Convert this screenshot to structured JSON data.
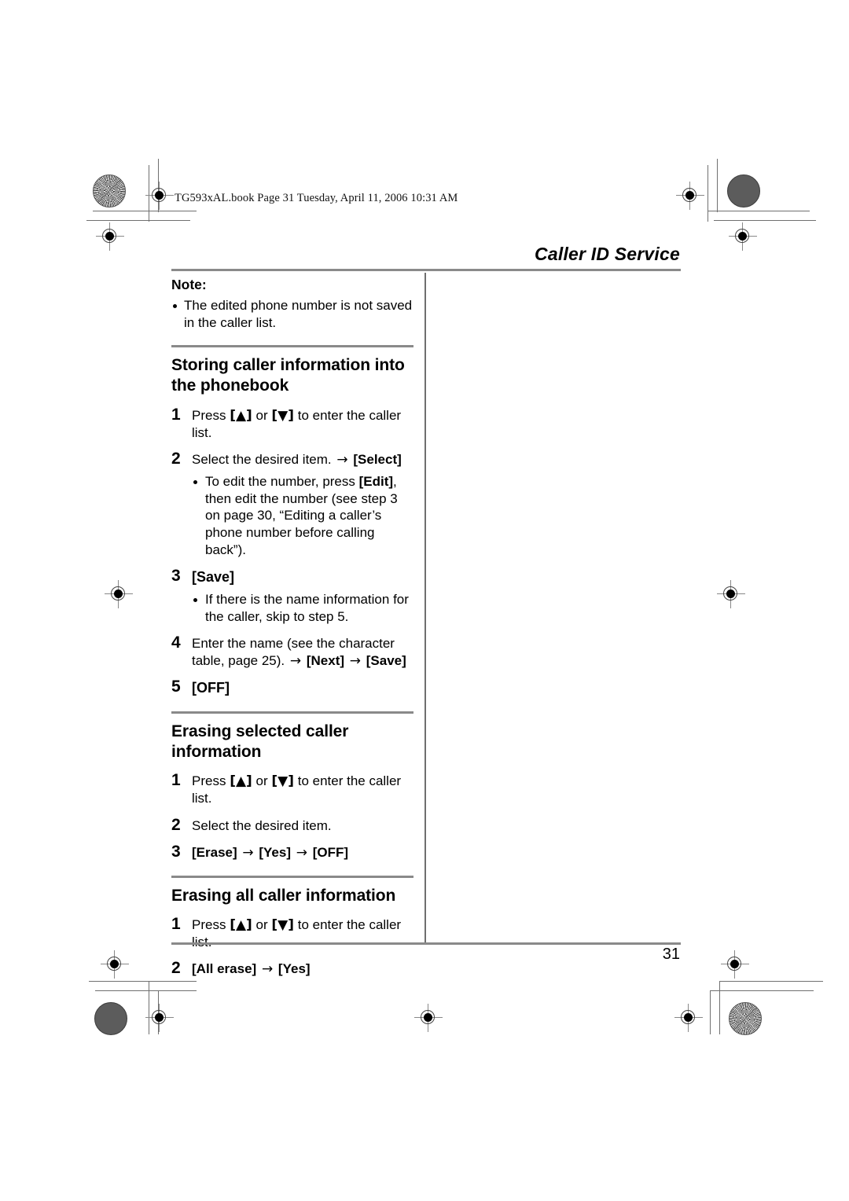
{
  "document": {
    "book_slug": "TG593xAL.book  Page 31  Tuesday, April 11, 2006  10:31 AM",
    "running_head": "Caller ID Service",
    "page_number": "31"
  },
  "note": {
    "label": "Note:",
    "items": [
      "The edited phone number is not saved in the caller list."
    ]
  },
  "sections": [
    {
      "title": "Storing caller information into the phonebook",
      "steps": [
        {
          "num": "1",
          "parts": [
            {
              "t": "text",
              "v": "Press "
            },
            {
              "t": "navkey",
              "v": "[▲]"
            },
            {
              "t": "text",
              "v": " or "
            },
            {
              "t": "navkey",
              "v": "[▼]"
            },
            {
              "t": "text",
              "v": " to enter the caller list."
            }
          ],
          "sub": []
        },
        {
          "num": "2",
          "parts": [
            {
              "t": "text",
              "v": "Select the desired item. "
            },
            {
              "t": "arrow",
              "v": "→"
            },
            {
              "t": "text",
              "v": " "
            },
            {
              "t": "key",
              "v": "[Select]"
            }
          ],
          "sub": [
            {
              "parts": [
                {
                  "t": "text",
                  "v": "To edit the number, press "
                },
                {
                  "t": "key",
                  "v": "[Edit]"
                },
                {
                  "t": "text",
                  "v": ", then edit the number (see step 3 on page 30, “Editing a caller’s phone number before calling back”)."
                }
              ]
            }
          ]
        },
        {
          "num": "3",
          "parts": [
            {
              "t": "key",
              "v": "[Save]"
            }
          ],
          "sub": [
            {
              "parts": [
                {
                  "t": "text",
                  "v": "If there is the name information for the caller, skip to step 5."
                }
              ]
            }
          ]
        },
        {
          "num": "4",
          "parts": [
            {
              "t": "text",
              "v": "Enter the name (see the character table, page 25). "
            },
            {
              "t": "arrow",
              "v": "→"
            },
            {
              "t": "text",
              "v": " "
            },
            {
              "t": "key",
              "v": "[Next]"
            },
            {
              "t": "text",
              "v": " "
            },
            {
              "t": "arrow",
              "v": "→"
            },
            {
              "t": "text",
              "v": " "
            },
            {
              "t": "key",
              "v": "[Save]"
            }
          ],
          "sub": []
        },
        {
          "num": "5",
          "parts": [
            {
              "t": "key",
              "v": "[OFF]"
            }
          ],
          "sub": []
        }
      ]
    },
    {
      "title": "Erasing selected caller information",
      "steps": [
        {
          "num": "1",
          "parts": [
            {
              "t": "text",
              "v": "Press "
            },
            {
              "t": "navkey",
              "v": "[▲]"
            },
            {
              "t": "text",
              "v": " or "
            },
            {
              "t": "navkey",
              "v": "[▼]"
            },
            {
              "t": "text",
              "v": " to enter the caller list."
            }
          ],
          "sub": []
        },
        {
          "num": "2",
          "parts": [
            {
              "t": "text",
              "v": "Select the desired item."
            }
          ],
          "sub": []
        },
        {
          "num": "3",
          "parts": [
            {
              "t": "key",
              "v": "[Erase]"
            },
            {
              "t": "text",
              "v": " "
            },
            {
              "t": "arrow",
              "v": "→"
            },
            {
              "t": "text",
              "v": " "
            },
            {
              "t": "key",
              "v": "[Yes]"
            },
            {
              "t": "text",
              "v": " "
            },
            {
              "t": "arrow",
              "v": "→"
            },
            {
              "t": "text",
              "v": " "
            },
            {
              "t": "key",
              "v": "[OFF]"
            }
          ],
          "sub": []
        }
      ]
    },
    {
      "title": "Erasing all caller information",
      "steps": [
        {
          "num": "1",
          "parts": [
            {
              "t": "text",
              "v": "Press "
            },
            {
              "t": "navkey",
              "v": "[▲]"
            },
            {
              "t": "text",
              "v": " or "
            },
            {
              "t": "navkey",
              "v": "[▼]"
            },
            {
              "t": "text",
              "v": " to enter the caller list."
            }
          ],
          "sub": []
        },
        {
          "num": "2",
          "parts": [
            {
              "t": "key",
              "v": "[All erase]"
            },
            {
              "t": "text",
              "v": " "
            },
            {
              "t": "arrow",
              "v": "→"
            },
            {
              "t": "text",
              "v": " "
            },
            {
              "t": "key",
              "v": "[Yes]"
            }
          ],
          "sub": []
        }
      ]
    }
  ],
  "colors": {
    "rule": "#8a8a8a",
    "text": "#000000",
    "page": "#ffffff",
    "mark": "#5c5c5c"
  }
}
